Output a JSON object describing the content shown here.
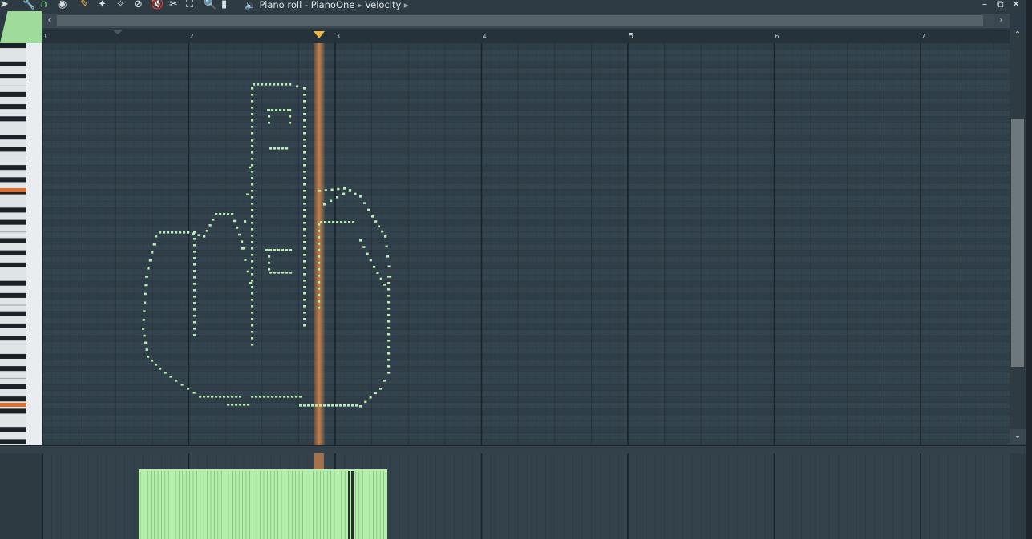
{
  "toolbar": {
    "title": "Piano roll - PianoOne",
    "separator": "▸",
    "velocity": "Velocity",
    "tools": [
      {
        "name": "pointer-icon",
        "glyph": "➤"
      },
      {
        "name": "wrench-icon",
        "glyph": "🔧"
      },
      {
        "name": "magnet-icon",
        "glyph": "∩"
      },
      {
        "name": "playback-icon",
        "glyph": "◉"
      },
      {
        "name": "pencil-icon",
        "glyph": "✎"
      },
      {
        "name": "brush-icon",
        "glyph": "✦"
      },
      {
        "name": "erase-brush-icon",
        "glyph": "✧"
      },
      {
        "name": "delete-icon",
        "glyph": "⊘"
      },
      {
        "name": "mute-icon",
        "glyph": "🔇"
      },
      {
        "name": "slice-icon",
        "glyph": "✂"
      },
      {
        "name": "select-icon",
        "glyph": "⛶"
      },
      {
        "name": "zoom-icon",
        "glyph": "🔍"
      },
      {
        "name": "playback-tool-icon",
        "glyph": "▮"
      },
      {
        "name": "speaker-icon",
        "glyph": "🔈"
      }
    ]
  },
  "window_controls": {
    "minimize": "–",
    "restore": "⧉",
    "close": "✕"
  },
  "scroll": {
    "left": "‹",
    "right": "›",
    "down": "⌄"
  },
  "ruler": {
    "bars": [
      "1",
      "2",
      "3",
      "4",
      "5",
      "6",
      "7"
    ],
    "emphasized_bar": "5"
  },
  "colors": {
    "note": "#b8f0b0",
    "playhead": "#d6874a",
    "grid_bg": "#34444e",
    "grid_alt": "#2f3e47",
    "velocity": "#b5efac"
  },
  "piano_roll": {
    "playhead_bar_position": 2.89,
    "highlighted_keys": [
      "C6",
      "C4"
    ]
  }
}
